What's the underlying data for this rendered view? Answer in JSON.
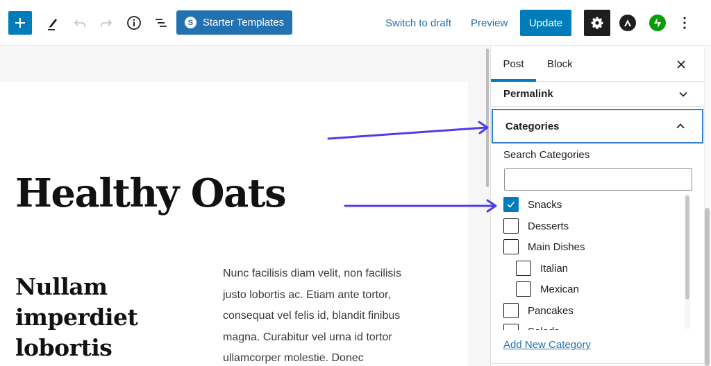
{
  "toolbar": {
    "add_block_icon": "plus-icon",
    "tools_icon": "pencil-icon",
    "undo_icon": "undo-icon",
    "redo_icon": "redo-icon",
    "details_icon": "info-icon",
    "list_view_icon": "list-view-icon",
    "starter_templates_label": "Starter Templates",
    "starter_templates_logo": "S",
    "switch_to_draft_label": "Switch to draft",
    "preview_label": "Preview",
    "update_label": "Update",
    "settings_icon": "gear-icon",
    "astra_icon": "astra-logo-icon",
    "jetpack_icon": "jetpack-logo-icon",
    "more_icon": "more-vertical-icon"
  },
  "colors": {
    "primary": "#007cba",
    "starter_btn": "#2271b1",
    "link": "#2271b1",
    "jetpack": "#069e08",
    "annotation_arrow": "#4f3ce8",
    "focus_border": "#3582c4"
  },
  "editor": {
    "title": "Healthy Oats",
    "sub_heading": "Nullam imperdiet lobortis",
    "body_lines": [
      "Nunc facilisis diam velit, non facilisis",
      "justo lobortis ac. Etiam ante tortor,",
      "consequat vel felis id, blandit finibus",
      "magna. Curabitur vel urna id tortor",
      "ullamcorper molestie. Donec"
    ]
  },
  "sidebar": {
    "tabs": [
      {
        "label": "Post",
        "active": true
      },
      {
        "label": "Block",
        "active": false
      }
    ],
    "close_icon": "close-icon",
    "panels": {
      "permalink": {
        "label": "Permalink",
        "expanded": false
      },
      "categories": {
        "label": "Categories",
        "expanded": true
      }
    },
    "search_label": "Search Categories",
    "search_value": "",
    "categories": [
      {
        "label": "Snacks",
        "checked": true,
        "level": 0
      },
      {
        "label": "Desserts",
        "checked": false,
        "level": 0
      },
      {
        "label": "Main Dishes",
        "checked": false,
        "level": 0
      },
      {
        "label": "Italian",
        "checked": false,
        "level": 1
      },
      {
        "label": "Mexican",
        "checked": false,
        "level": 1
      },
      {
        "label": "Pancakes",
        "checked": false,
        "level": 0
      },
      {
        "label": "Salads",
        "checked": false,
        "level": 0
      }
    ],
    "add_new_label": "Add New Category"
  }
}
